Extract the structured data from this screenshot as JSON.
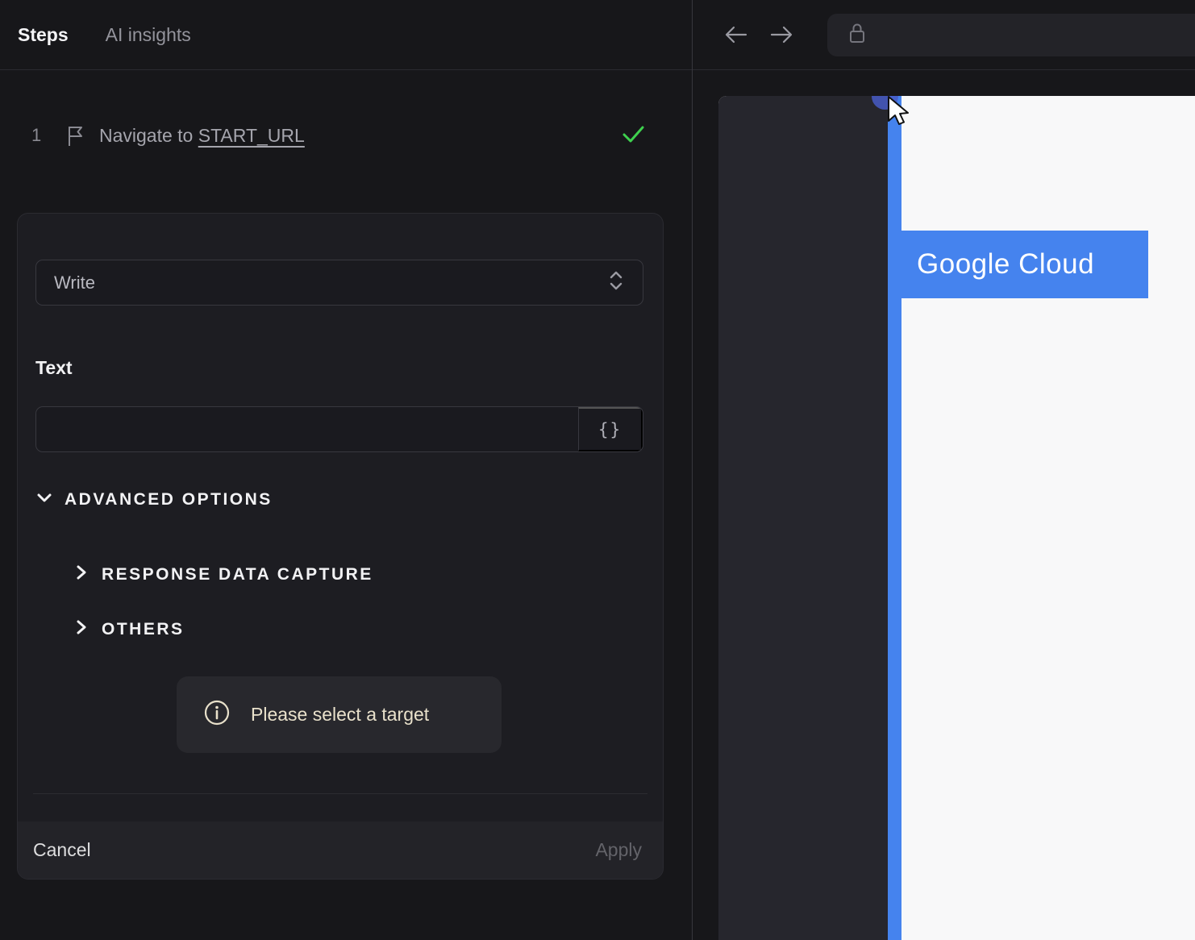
{
  "colors": {
    "accent_blue": "#4583ee",
    "success_green": "#3ed14e",
    "hint_cream": "#e9e1cb",
    "panel_bg": "#17171a",
    "card_bg": "#1d1d22",
    "preview_sidebar": "#26262d",
    "page_white": "#f8f8f9"
  },
  "left_panel": {
    "tabs": [
      {
        "label": "Steps"
      },
      {
        "label": "AI insights"
      }
    ],
    "step": {
      "index": "1",
      "action_text": "Navigate to",
      "target_text": "START_URL"
    },
    "editor": {
      "action_select": {
        "value": "Write"
      },
      "text_field": {
        "label": "Text",
        "value": "",
        "placeholder": ""
      },
      "braces_button_label": "{}",
      "advanced_options_label": "ADVANCED OPTIONS",
      "sections": [
        {
          "label": "RESPONSE DATA CAPTURE"
        },
        {
          "label": "OTHERS"
        }
      ],
      "target_hint": "Please select a target",
      "cancel_label": "Cancel",
      "apply_label": "Apply"
    }
  },
  "browser": {
    "url_value": "",
    "page": {
      "brand": "Google Cloud"
    }
  },
  "icons": [
    "flag-icon",
    "check-icon",
    "up-down-chevron-icon",
    "chevron-down-icon",
    "chevron-right-icon",
    "info-icon",
    "back-arrow-icon",
    "forward-arrow-icon",
    "lock-icon",
    "cursor-pointer-icon"
  ]
}
